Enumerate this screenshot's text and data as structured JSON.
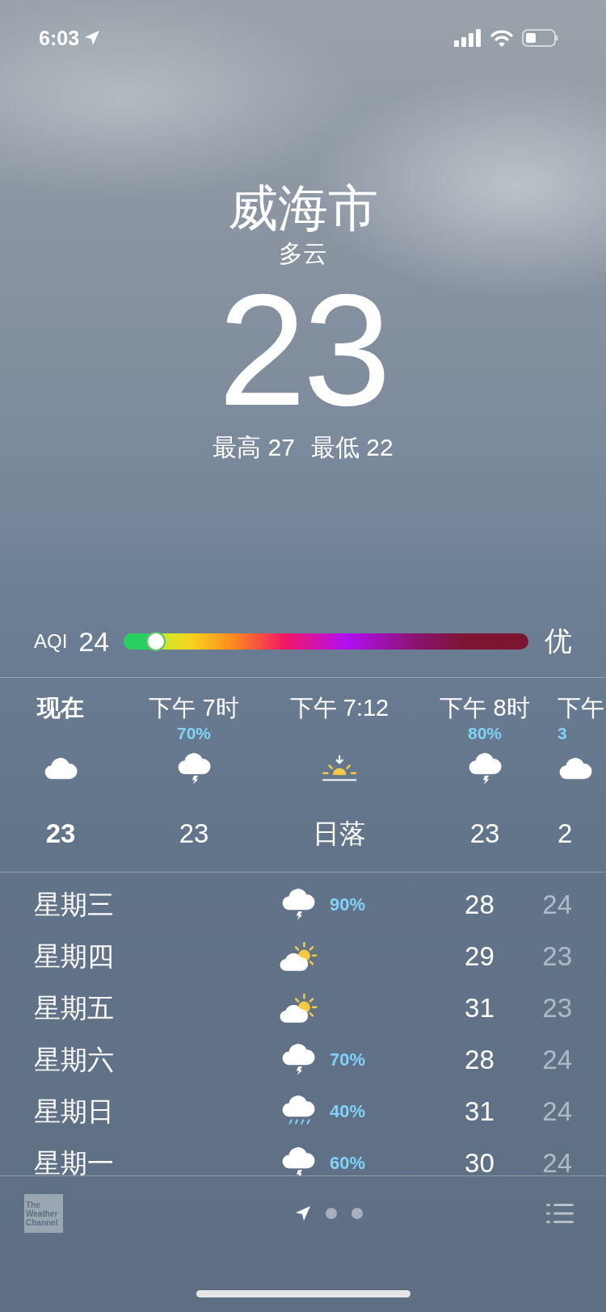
{
  "status_bar": {
    "time": "6:03",
    "location_on": true
  },
  "header": {
    "city": "威海市",
    "condition": "多云",
    "temperature": "23",
    "high_label": "最高",
    "high": "27",
    "low_label": "最低",
    "low": "22"
  },
  "aqi": {
    "label": "AQI",
    "value": "24",
    "level": 0.08,
    "rating": "优"
  },
  "hourly": [
    {
      "time": "现在",
      "current": true,
      "kind": "cloudy",
      "temp": "23"
    },
    {
      "time": "下午 7时",
      "current": false,
      "precip": "70%",
      "kind": "thunderstorm",
      "temp": "23"
    },
    {
      "time": "下午 7:12",
      "current": false,
      "kind": "sunset",
      "temp": "日落"
    },
    {
      "time": "下午 8时",
      "current": false,
      "precip": "80%",
      "kind": "thunderstorm",
      "temp": "23"
    },
    {
      "time": "下午",
      "current": false,
      "precip": "3",
      "kind": "cloudy",
      "temp": "2"
    }
  ],
  "daily": [
    {
      "day": "星期三",
      "kind": "thunderstorm",
      "precip": "90%",
      "high": "28",
      "low": "24"
    },
    {
      "day": "星期四",
      "kind": "partly_sunny",
      "high": "29",
      "low": "23"
    },
    {
      "day": "星期五",
      "kind": "partly_sunny",
      "high": "31",
      "low": "23"
    },
    {
      "day": "星期六",
      "kind": "thunderstorm",
      "precip": "70%",
      "high": "28",
      "low": "24"
    },
    {
      "day": "星期日",
      "kind": "rain",
      "precip": "40%",
      "high": "31",
      "low": "24"
    },
    {
      "day": "星期一",
      "kind": "thunderstorm",
      "precip": "60%",
      "high": "30",
      "low": "24"
    }
  ],
  "footer": {
    "logo_lines": [
      "The",
      "Weather",
      "Channel"
    ],
    "pages": [
      {
        "kind": "location",
        "selected": true
      },
      {
        "kind": "dot",
        "selected": false
      },
      {
        "kind": "dot",
        "selected": false
      }
    ]
  }
}
